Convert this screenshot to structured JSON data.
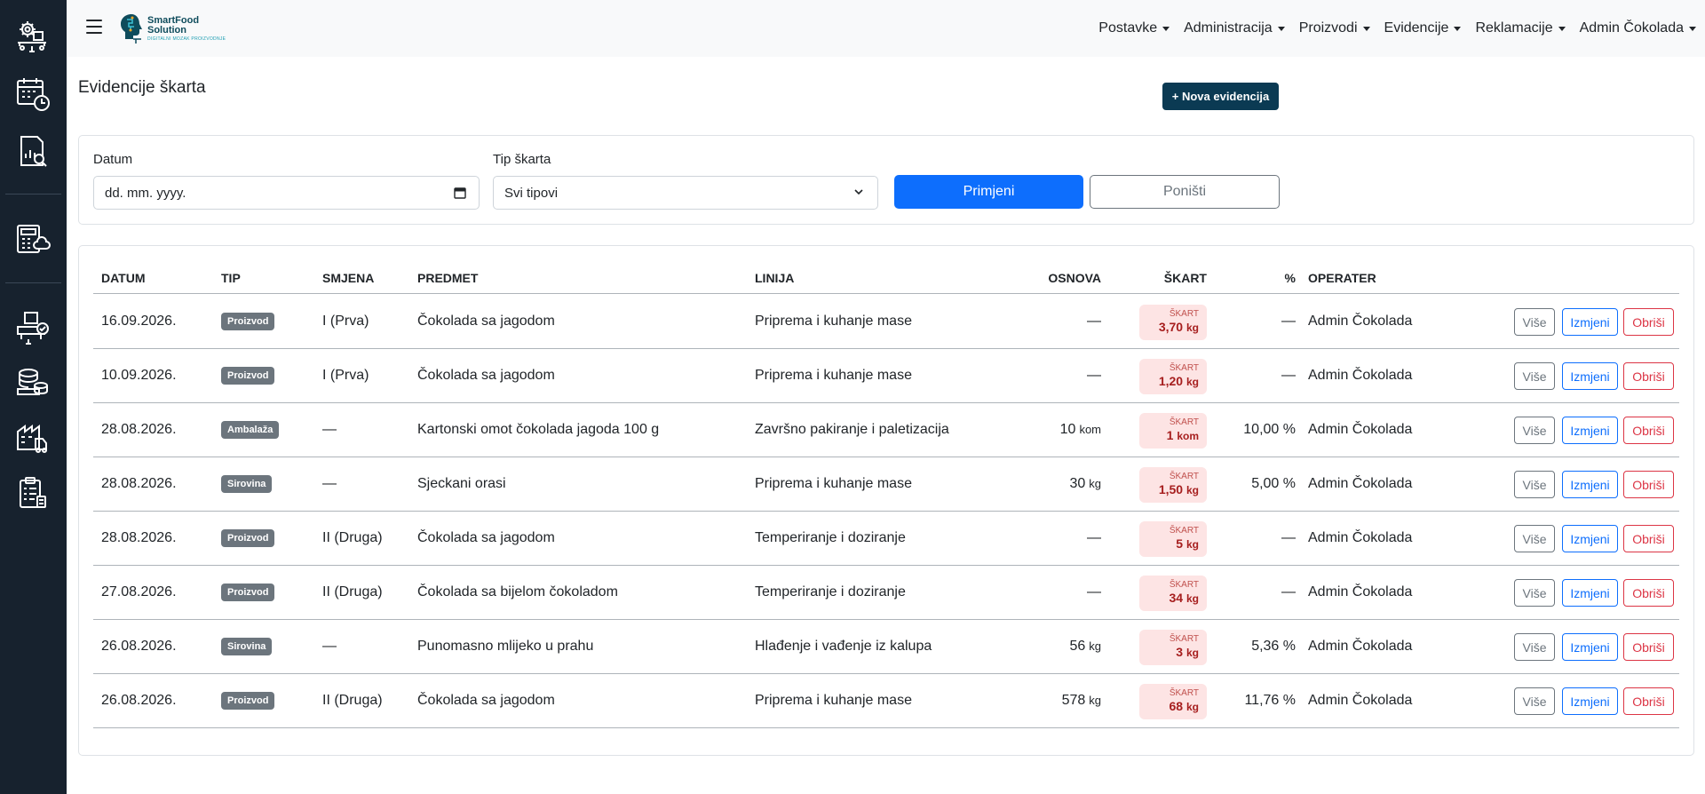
{
  "header": {
    "logo": {
      "line1": "SmartFood",
      "line2": "Solution",
      "tagline": "DIGITALNI MOZAK PROIZVODNJE"
    },
    "nav": [
      {
        "label": "Postavke"
      },
      {
        "label": "Administracija"
      },
      {
        "label": "Proizvodi"
      },
      {
        "label": "Evidencije"
      },
      {
        "label": "Reklamacije"
      },
      {
        "label": "Admin Čokolada"
      }
    ]
  },
  "page": {
    "title": "Evidencije škarta",
    "new_button": "+ Nova evidencija"
  },
  "filters": {
    "date_label": "Datum",
    "date_placeholder": "dd. mm. yyyy.",
    "type_label": "Tip škarta",
    "type_selected": "Svi tipovi",
    "apply_label": "Primjeni",
    "reset_label": "Poništi"
  },
  "table": {
    "headers": {
      "datum": "DATUM",
      "tip": "TIP",
      "smjena": "SMJENA",
      "predmet": "PREDMET",
      "linija": "LINIJA",
      "osnova": "OSNOVA",
      "skart": "ŠKART",
      "pct": "%",
      "operater": "OPERATER"
    },
    "skart_label": "ŠKART",
    "actions": {
      "more": "Više",
      "edit": "Izmjeni",
      "delete": "Obriši"
    },
    "rows": [
      {
        "datum": "16.09.2026.",
        "tip": "Proizvod",
        "smjena": "I (Prva)",
        "predmet": "Čokolada sa jagodom",
        "linija": "Priprema i kuhanje mase",
        "osnova": "—",
        "osnova_unit": "",
        "skart_value": "3,70",
        "skart_unit": "kg",
        "pct": "—",
        "operater": "Admin Čokolada"
      },
      {
        "datum": "10.09.2026.",
        "tip": "Proizvod",
        "smjena": "I (Prva)",
        "predmet": "Čokolada sa jagodom",
        "linija": "Priprema i kuhanje mase",
        "osnova": "—",
        "osnova_unit": "",
        "skart_value": "1,20",
        "skart_unit": "kg",
        "pct": "—",
        "operater": "Admin Čokolada"
      },
      {
        "datum": "28.08.2026.",
        "tip": "Ambalaža",
        "smjena": "—",
        "predmet": "Kartonski omot čokolada jagoda 100 g",
        "linija": "Završno pakiranje i paletizacija",
        "osnova": "10",
        "osnova_unit": "kom",
        "skart_value": "1",
        "skart_unit": "kom",
        "pct": "10,00 %",
        "operater": "Admin Čokolada"
      },
      {
        "datum": "28.08.2026.",
        "tip": "Sirovina",
        "smjena": "—",
        "predmet": "Sjeckani orasi",
        "linija": "Priprema i kuhanje mase",
        "osnova": "30",
        "osnova_unit": "kg",
        "skart_value": "1,50",
        "skart_unit": "kg",
        "pct": "5,00 %",
        "operater": "Admin Čokolada"
      },
      {
        "datum": "28.08.2026.",
        "tip": "Proizvod",
        "smjena": "II (Druga)",
        "predmet": "Čokolada sa jagodom",
        "linija": "Temperiranje i doziranje",
        "osnova": "—",
        "osnova_unit": "",
        "skart_value": "5",
        "skart_unit": "kg",
        "pct": "—",
        "operater": "Admin Čokolada"
      },
      {
        "datum": "27.08.2026.",
        "tip": "Proizvod",
        "smjena": "II (Druga)",
        "predmet": "Čokolada sa bijelom čokoladom",
        "linija": "Temperiranje i doziranje",
        "osnova": "—",
        "osnova_unit": "",
        "skart_value": "34",
        "skart_unit": "kg",
        "pct": "—",
        "operater": "Admin Čokolada"
      },
      {
        "datum": "26.08.2026.",
        "tip": "Sirovina",
        "smjena": "—",
        "predmet": "Punomasno mlijeko u prahu",
        "linija": "Hlađenje i vađenje iz kalupa",
        "osnova": "56",
        "osnova_unit": "kg",
        "skart_value": "3",
        "skart_unit": "kg",
        "pct": "5,36 %",
        "operater": "Admin Čokolada"
      },
      {
        "datum": "26.08.2026.",
        "tip": "Proizvod",
        "smjena": "II (Druga)",
        "predmet": "Čokolada sa jagodom",
        "linija": "Priprema i kuhanje mase",
        "osnova": "578",
        "osnova_unit": "kg",
        "skart_value": "68",
        "skart_unit": "kg",
        "pct": "11,76 %",
        "operater": "Admin Čokolada"
      }
    ]
  },
  "sidebar": {
    "icons": [
      "settings-conveyor-icon",
      "calendar-clock-icon",
      "report-search-icon",
      "calculator-cloud-icon",
      "package-check-icon",
      "stack-coins-icon",
      "factory-truck-icon",
      "clipboard-list-icon"
    ]
  },
  "colors": {
    "sidebar_bg": "#17222e",
    "primary": "#0d6efd",
    "new_button": "#0b3a53",
    "danger": "#dc3545",
    "skart_bg": "#fde4e4",
    "skart_text": "#a61e1e"
  }
}
